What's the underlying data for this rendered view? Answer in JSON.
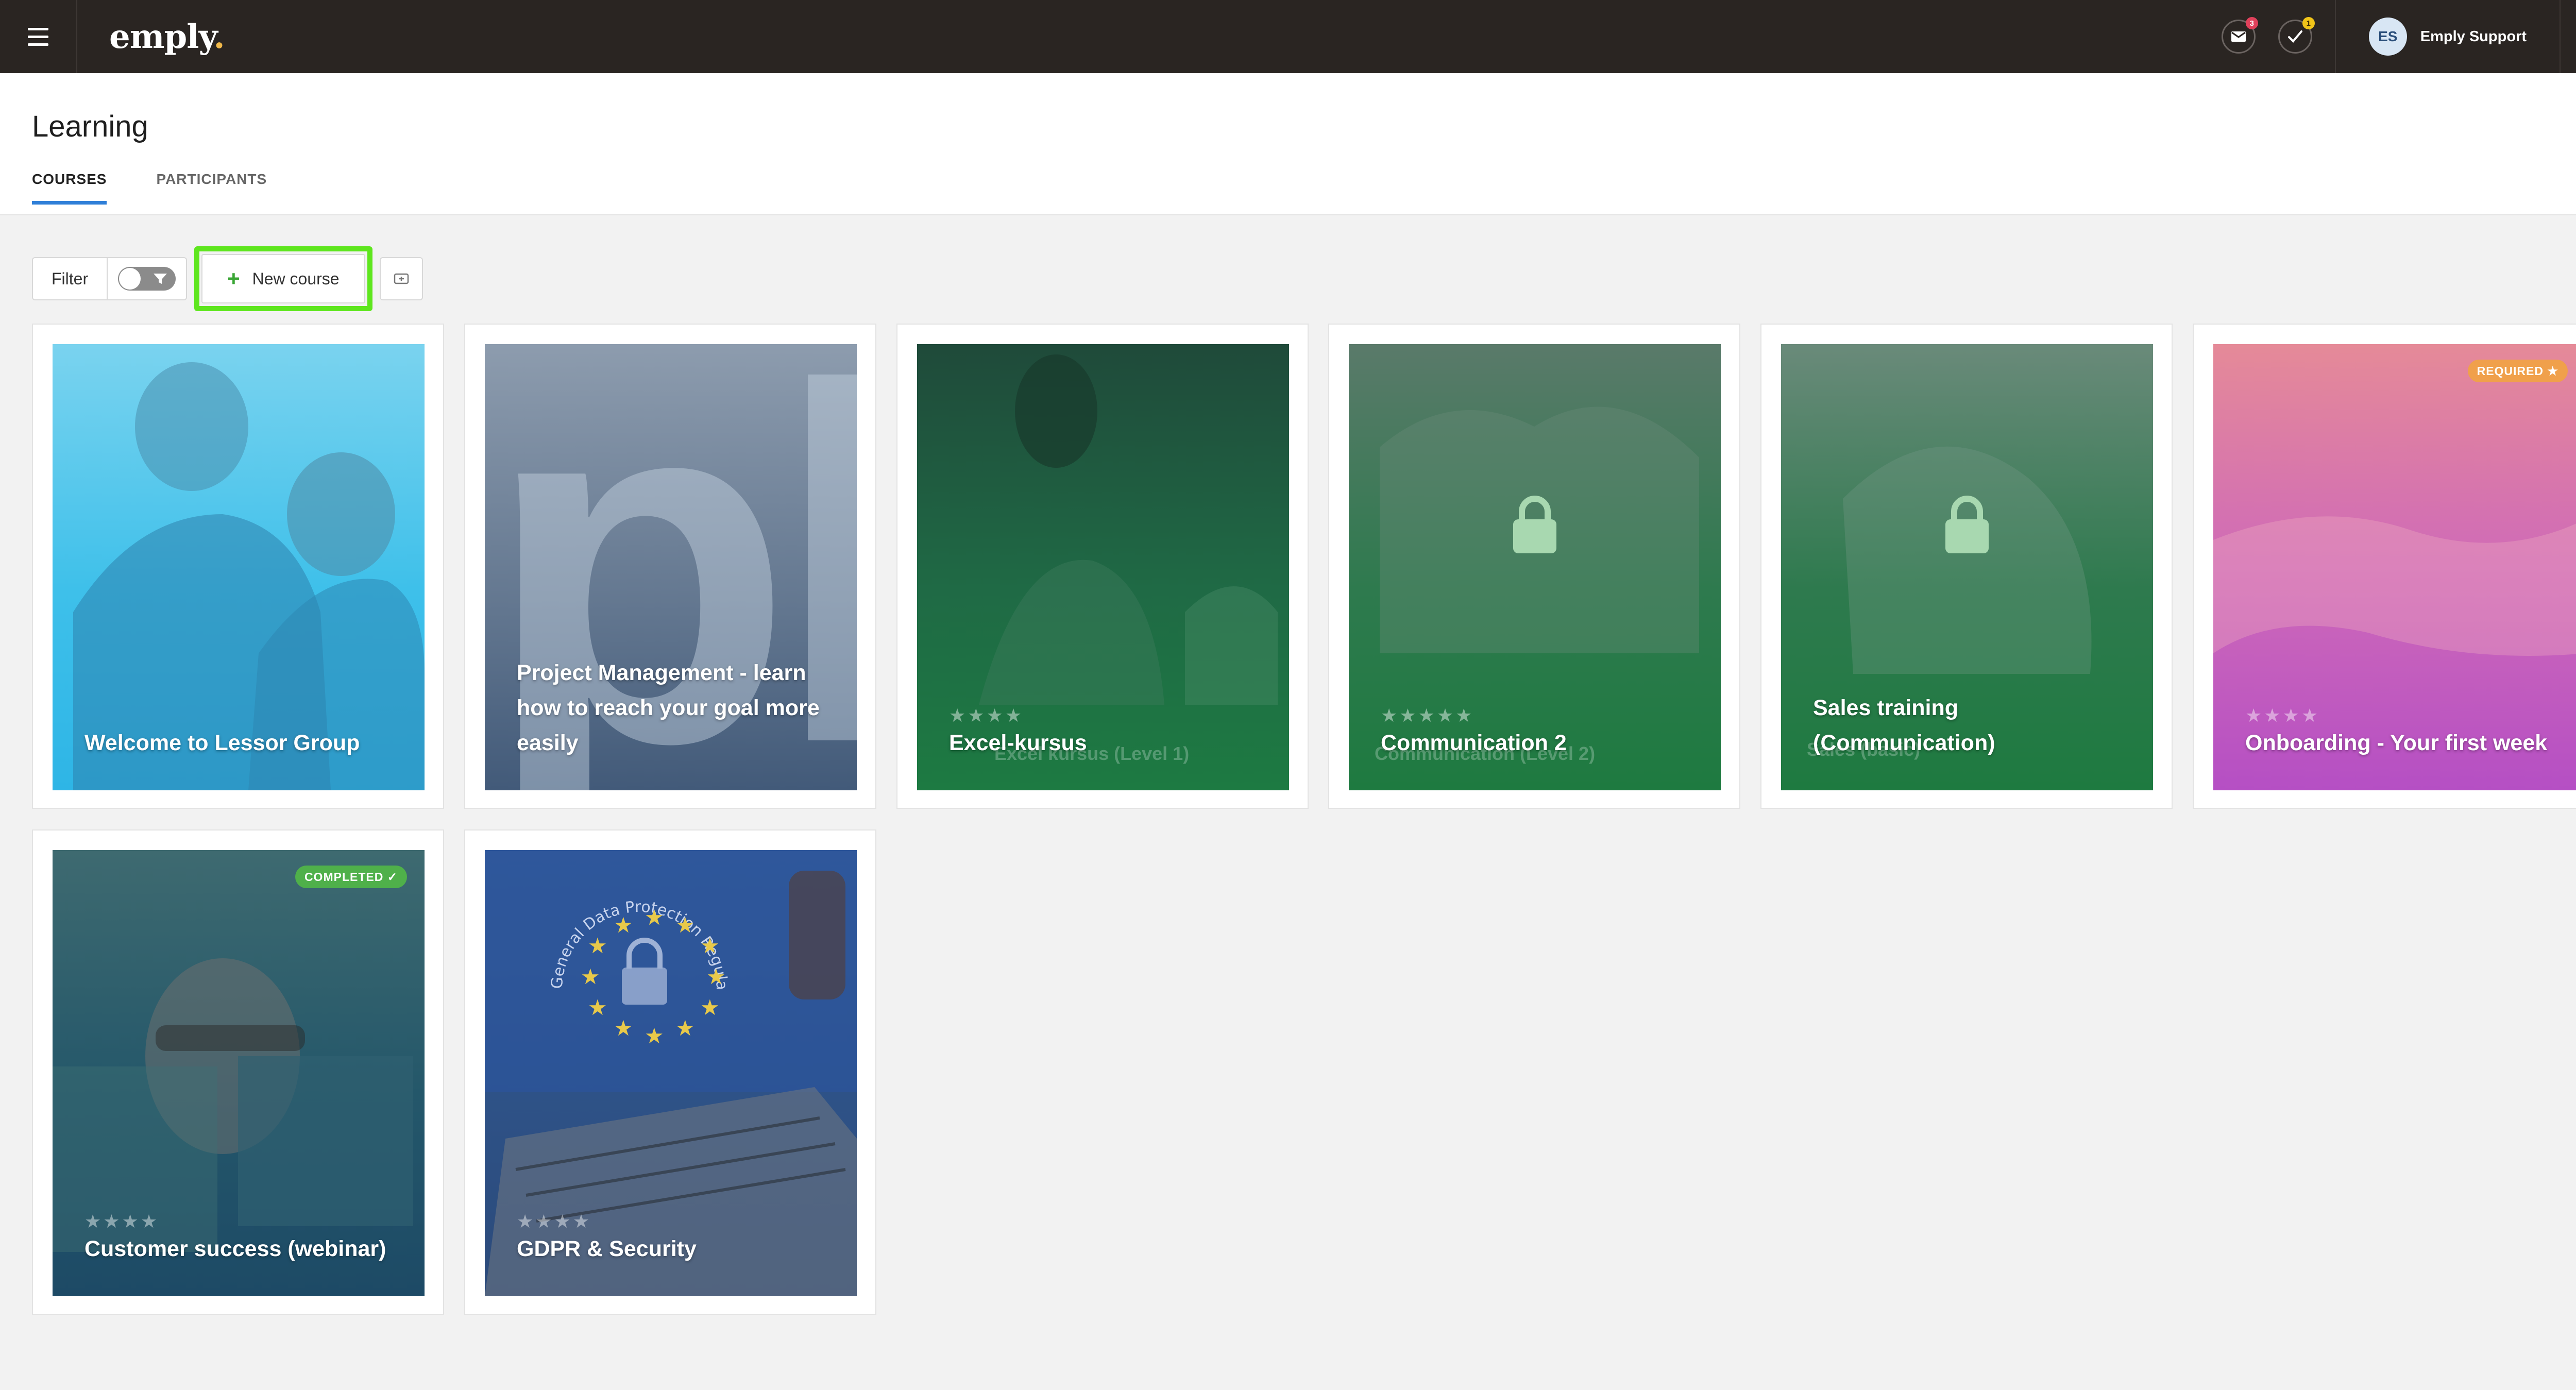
{
  "topbar": {
    "logo": "emply",
    "logo_dot": ".",
    "mail_badge": "3",
    "tasks_badge": "1",
    "user_initials": "ES",
    "user_name": "Emply Support"
  },
  "header": {
    "title": "Learning",
    "tabs": [
      {
        "label": "COURSES",
        "active": true
      },
      {
        "label": "PARTICIPANTS",
        "active": false
      }
    ]
  },
  "toolbar": {
    "filter_label": "Filter",
    "new_course_label": "New course"
  },
  "courses": [
    {
      "title": "Welcome to Lessor Group"
    },
    {
      "title": "Project Management - learn how to reach your goal more easily",
      "letters": "pl"
    },
    {
      "title": "Excel-kursus",
      "stars": "★★★★",
      "subtitle": "Excel kursus (Level 1)"
    },
    {
      "title": "Communication 2",
      "stars": "★★★★★",
      "subtitle": "Communication (Level 2)",
      "locked": true
    },
    {
      "title": "Sales training (Communication)",
      "subtitle": "Sales (basic)",
      "locked": true
    },
    {
      "title": "Onboarding - Your first week",
      "stars": "★★★★",
      "tag": "REQUIRED ★"
    },
    {
      "title": "Customer success (webinar)",
      "stars": "★★★★",
      "tag": "COMPLETED ✓"
    },
    {
      "title": "GDPR & Security",
      "stars": "★★★★",
      "seal_text": "General Data Protection Regulation (GDPR)"
    }
  ],
  "colors": {
    "topbar_bg": "#2a2522",
    "accent_tab": "#2f7fd8",
    "highlight": "#5ee61e",
    "mail_badge": "#e0415b",
    "tasks_badge": "#f0c419",
    "required_tag": "#f0a04b",
    "completed_tag": "#4fb04a"
  },
  "icons": [
    "hamburger-icon",
    "mail-icon",
    "check-icon",
    "search-icon",
    "funnel-icon",
    "plus-icon",
    "import-icon",
    "lock-icon"
  ]
}
